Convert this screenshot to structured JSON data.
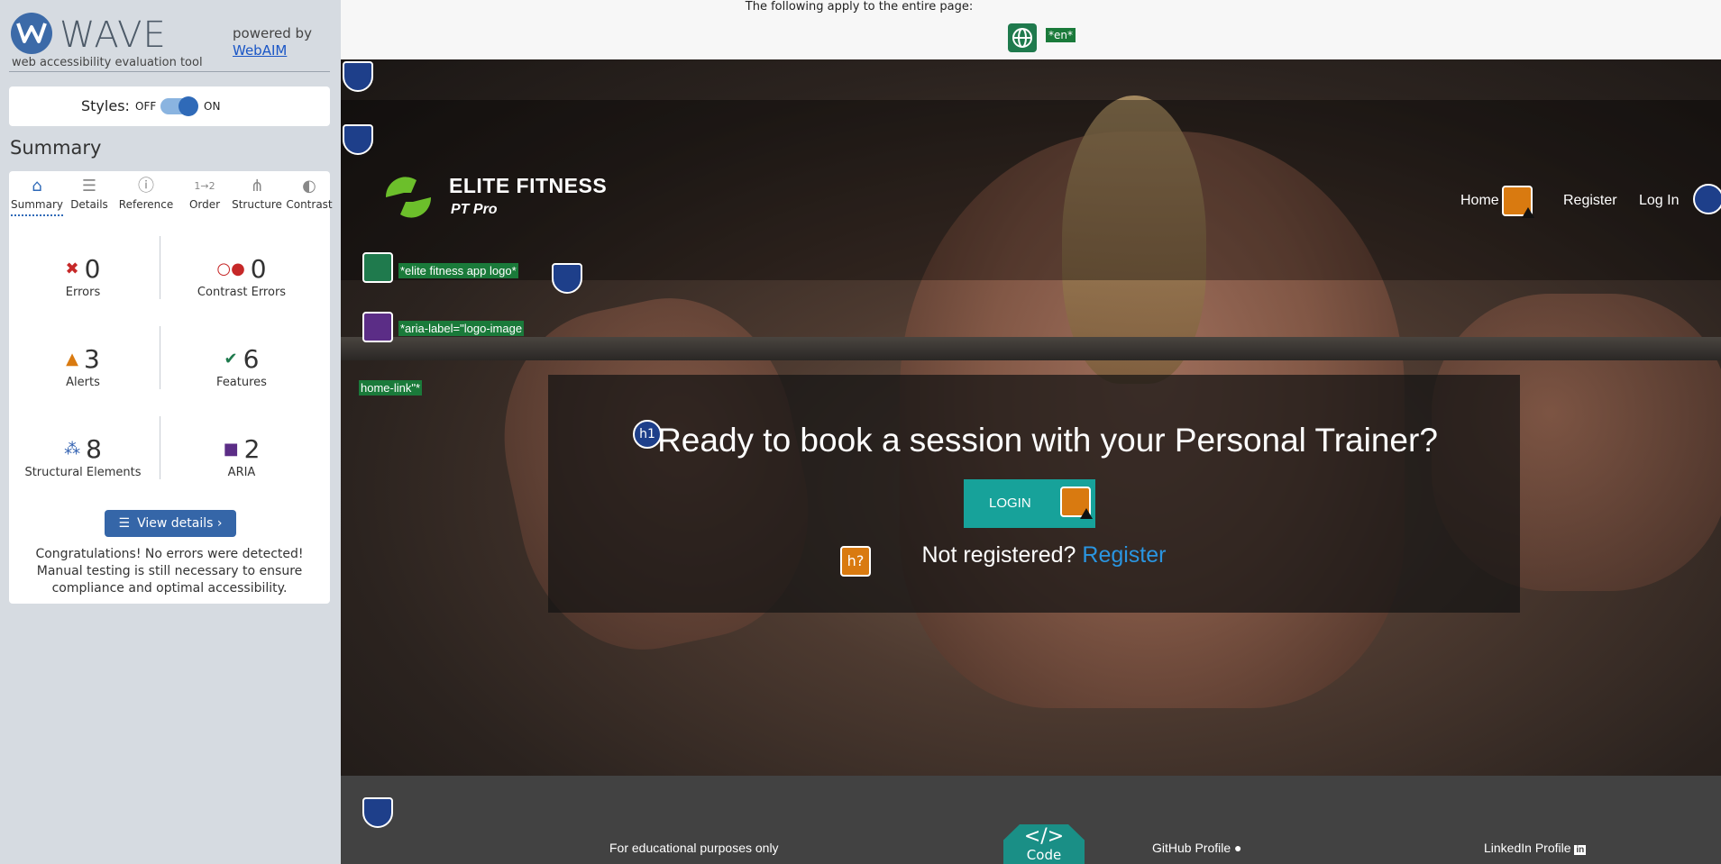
{
  "wave": {
    "title": "WAVE",
    "subtitle": "web accessibility evaluation tool",
    "powered_by": "powered by",
    "webaim_link": "WebAIM",
    "styles_label": "Styles:",
    "styles_off": "OFF",
    "styles_on": "ON",
    "summary_heading": "Summary",
    "tabs": [
      {
        "label": "Summary",
        "icon": "home-icon"
      },
      {
        "label": "Details",
        "icon": "list-icon"
      },
      {
        "label": "Reference",
        "icon": "info-icon"
      },
      {
        "label": "Order",
        "icon": "order-icon"
      },
      {
        "label": "Structure",
        "icon": "structure-icon"
      },
      {
        "label": "Contrast",
        "icon": "contrast-icon"
      }
    ],
    "stats": {
      "errors": {
        "count": "0",
        "label": "Errors"
      },
      "contrast_errors": {
        "count": "0",
        "label": "Contrast Errors"
      },
      "alerts": {
        "count": "3",
        "label": "Alerts"
      },
      "features": {
        "count": "6",
        "label": "Features"
      },
      "structural": {
        "count": "8",
        "label": "Structural Elements"
      },
      "aria": {
        "count": "2",
        "label": "ARIA"
      }
    },
    "view_details": "View details ›",
    "congrats": "Congratulations! No errors were detected! Manual testing is still necessary to ensure compliance and optimal accessibility."
  },
  "page": {
    "top_note": "The following apply to the entire page:",
    "lang_badge": "*en*",
    "brand_name": "ELITE FITNESS",
    "brand_sub": "PT Pro",
    "nav": {
      "home": "Home",
      "register": "Register",
      "login": "Log In"
    },
    "labels": {
      "logo_alt": "*elite fitness app logo*",
      "aria_label": "*aria-label=\"logo-image",
      "home_link": "home-link\"*"
    },
    "cta_title": "Ready to book a session with your Personal Trainer?",
    "login_button": "LOGIN",
    "not_registered": "Not registered?",
    "register_link": "Register",
    "h1_badge": "h1",
    "hq_badge": "h?",
    "footer": {
      "edu": "For educational purposes only",
      "code_glyph": "</>",
      "code_label": "Code",
      "github": "GitHub Profile",
      "linkedin": "LinkedIn Profile"
    }
  },
  "colors": {
    "wave_blue": "#3566a8",
    "feature_green": "#1a7a3a",
    "alert_orange": "#d97a10",
    "aria_purple": "#5b2d86",
    "teal": "#17a29a"
  }
}
